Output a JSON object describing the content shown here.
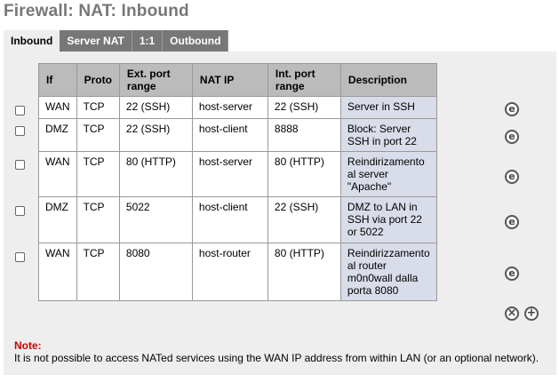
{
  "page": {
    "title": "Firewall: NAT: Inbound"
  },
  "tabs": [
    {
      "label": "Inbound",
      "active": true
    },
    {
      "label": "Server NAT",
      "active": false
    },
    {
      "label": "1:1",
      "active": false
    },
    {
      "label": "Outbound",
      "active": false
    }
  ],
  "table": {
    "headers": {
      "if": "If",
      "proto": "Proto",
      "ext_port": "Ext. port range",
      "nat_ip": "NAT IP",
      "int_port": "Int. port range",
      "description": "Description"
    },
    "rows": [
      {
        "if": "WAN",
        "proto": "TCP",
        "ext_port": "22 (SSH)",
        "nat_ip": "host-server",
        "int_port": "22 (SSH)",
        "description": "Server in SSH"
      },
      {
        "if": "DMZ",
        "proto": "TCP",
        "ext_port": "22 (SSH)",
        "nat_ip": "host-client",
        "int_port": "8888",
        "description": "Block: Server SSH in port 22"
      },
      {
        "if": "WAN",
        "proto": "TCP",
        "ext_port": "80 (HTTP)",
        "nat_ip": "host-server",
        "int_port": "80 (HTTP)",
        "description": "Reindirizamento al server \"Apache\""
      },
      {
        "if": "DMZ",
        "proto": "TCP",
        "ext_port": "5022",
        "nat_ip": "host-client",
        "int_port": "22 (SSH)",
        "description": "DMZ to LAN in SSH via port 22 or 5022"
      },
      {
        "if": "WAN",
        "proto": "TCP",
        "ext_port": "8080",
        "nat_ip": "host-router",
        "int_port": "80 (HTTP)",
        "description": "Reindirizzamento al router m0n0wall dalla porta 8080"
      }
    ]
  },
  "icons": {
    "edit": "edit-icon",
    "delete": "delete-icon",
    "add": "add-icon",
    "edit_glyph": "e",
    "delete_glyph": "×",
    "add_glyph": "+"
  },
  "note": {
    "label": "Note:",
    "text": "It is not possible to access NATed services using the WAN IP address from within LAN (or an optional network)."
  }
}
